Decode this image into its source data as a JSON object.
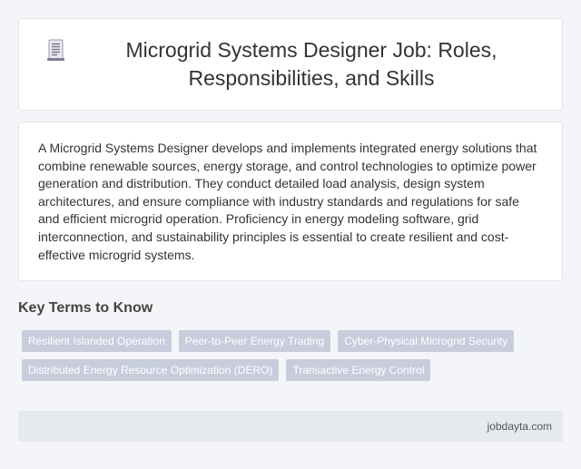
{
  "header": {
    "icon": "document-icon",
    "title": "Microgrid Systems Designer Job: Roles, Responsibilities, and Skills"
  },
  "summary": {
    "text": "A Microgrid Systems Designer develops and implements integrated energy solutions that combine renewable sources, energy storage, and control technologies to optimize power generation and distribution. They conduct detailed load analysis, design system architectures, and ensure compliance with industry standards and regulations for safe and efficient microgrid operation. Proficiency in energy modeling software, grid interconnection, and sustainability principles is essential to create resilient and cost-effective microgrid systems."
  },
  "key_terms": {
    "heading": "Key Terms to Know",
    "tags": [
      "Resilient Islanded Operation",
      "Peer-to-Peer Energy Trading",
      "Cyber-Physical Microgrid Security",
      "Distributed Energy Resource Optimization (DERO)",
      "Transactive Energy Control"
    ]
  },
  "footer": {
    "site": "jobdayta.com"
  },
  "colors": {
    "background": "#f4f5f8",
    "card": "#ffffff",
    "tag": "#c8cddd",
    "footer": "#e6eaee"
  }
}
